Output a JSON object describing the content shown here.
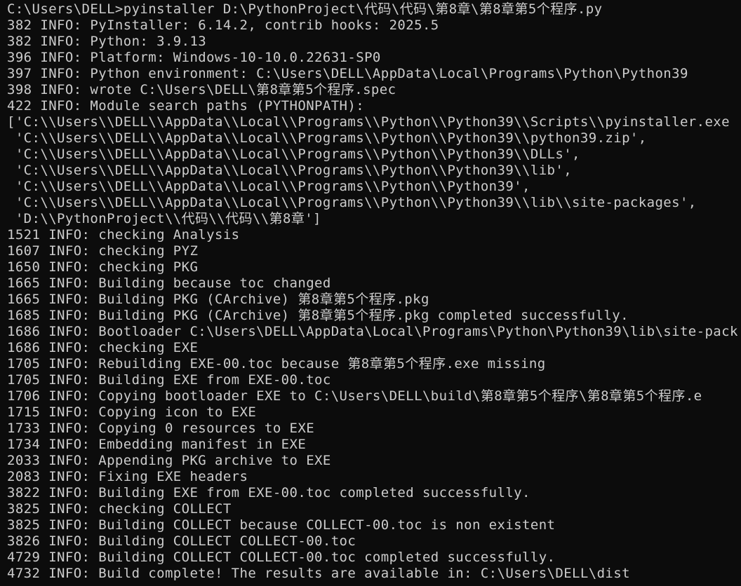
{
  "terminal": {
    "lines": [
      "C:\\Users\\DELL>pyinstaller D:\\PythonProject\\代码\\代码\\第8章\\第8章第5个程序.py",
      "382 INFO: PyInstaller: 6.14.2, contrib hooks: 2025.5",
      "382 INFO: Python: 3.9.13",
      "396 INFO: Platform: Windows-10-10.0.22631-SP0",
      "397 INFO: Python environment: C:\\Users\\DELL\\AppData\\Local\\Programs\\Python\\Python39",
      "398 INFO: wrote C:\\Users\\DELL\\第8章第5个程序.spec",
      "422 INFO: Module search paths (PYTHONPATH):",
      "['C:\\\\Users\\\\DELL\\\\AppData\\\\Local\\\\Programs\\\\Python\\\\Python39\\\\Scripts\\\\pyinstaller.exe",
      " 'C:\\\\Users\\\\DELL\\\\AppData\\\\Local\\\\Programs\\\\Python\\\\Python39\\\\python39.zip',",
      " 'C:\\\\Users\\\\DELL\\\\AppData\\\\Local\\\\Programs\\\\Python\\\\Python39\\\\DLLs',",
      " 'C:\\\\Users\\\\DELL\\\\AppData\\\\Local\\\\Programs\\\\Python\\\\Python39\\\\lib',",
      " 'C:\\\\Users\\\\DELL\\\\AppData\\\\Local\\\\Programs\\\\Python\\\\Python39',",
      " 'C:\\\\Users\\\\DELL\\\\AppData\\\\Local\\\\Programs\\\\Python\\\\Python39\\\\lib\\\\site-packages',",
      " 'D:\\\\PythonProject\\\\代码\\\\代码\\\\第8章']",
      "1521 INFO: checking Analysis",
      "1607 INFO: checking PYZ",
      "1650 INFO: checking PKG",
      "1665 INFO: Building because toc changed",
      "1665 INFO: Building PKG (CArchive) 第8章第5个程序.pkg",
      "1685 INFO: Building PKG (CArchive) 第8章第5个程序.pkg completed successfully.",
      "1686 INFO: Bootloader C:\\Users\\DELL\\AppData\\Local\\Programs\\Python\\Python39\\lib\\site-pack",
      "1686 INFO: checking EXE",
      "1705 INFO: Rebuilding EXE-00.toc because 第8章第5个程序.exe missing",
      "1705 INFO: Building EXE from EXE-00.toc",
      "1706 INFO: Copying bootloader EXE to C:\\Users\\DELL\\build\\第8章第5个程序\\第8章第5个程序.e",
      "1715 INFO: Copying icon to EXE",
      "1733 INFO: Copying 0 resources to EXE",
      "1734 INFO: Embedding manifest in EXE",
      "2033 INFO: Appending PKG archive to EXE",
      "2083 INFO: Fixing EXE headers",
      "3822 INFO: Building EXE from EXE-00.toc completed successfully.",
      "3825 INFO: checking COLLECT",
      "3825 INFO: Building COLLECT because COLLECT-00.toc is non existent",
      "3826 INFO: Building COLLECT COLLECT-00.toc",
      "4729 INFO: Building COLLECT COLLECT-00.toc completed successfully.",
      "4732 INFO: Build complete! The results are available in: C:\\Users\\DELL\\dist"
    ]
  },
  "colors": {
    "background": "#0c0c0c",
    "text": "#cccccc"
  }
}
